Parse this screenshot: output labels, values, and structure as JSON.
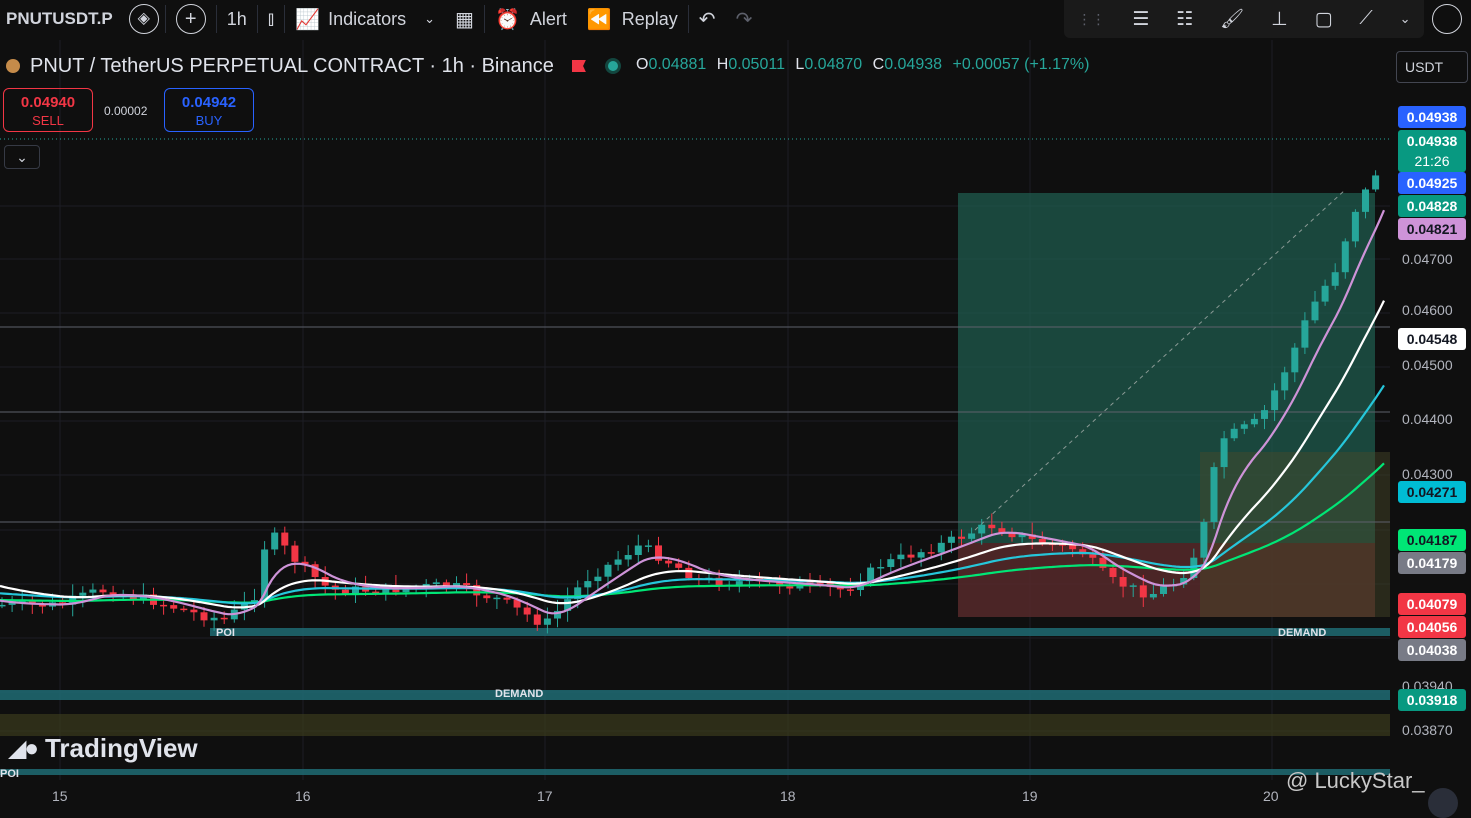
{
  "toolbar": {
    "symbol": "PNUTUSDT.P",
    "interval": "1h",
    "indicators_label": "Indicators",
    "alert_label": "Alert",
    "replay_label": "Replay"
  },
  "legend": {
    "title": "PNUT / TetherUS PERPETUAL CONTRACT · 1h · Binance",
    "o_key": "O",
    "o_val": "0.04881",
    "h_key": "H",
    "h_val": "0.05011",
    "l_key": "L",
    "l_val": "0.04870",
    "c_key": "C",
    "c_val": "0.04938",
    "change": "+0.00057 (+1.17%)"
  },
  "trade": {
    "sell_price": "0.04940",
    "sell_label": "SELL",
    "spread": "0.00002",
    "buy_price": "0.04942",
    "buy_label": "BUY"
  },
  "currency": "USDT",
  "price_axis": {
    "ticks": [
      "0.04700",
      "0.04600",
      "0.04500",
      "0.04400",
      "0.04300",
      "0.03940",
      "0.03870"
    ],
    "labels": [
      {
        "text": "0.04938",
        "bg": "#2962ff",
        "fg": "#ffffff"
      },
      {
        "text": "0.04938",
        "bg": "#089981",
        "fg": "#ffffff"
      },
      {
        "text": "21:26",
        "bg": "#089981",
        "fg": "#ffffff"
      },
      {
        "text": "0.04925",
        "bg": "#2962ff",
        "fg": "#ffffff"
      },
      {
        "text": "0.04828",
        "bg": "#089981",
        "fg": "#ffffff"
      },
      {
        "text": "0.04821",
        "bg": "#ce93d8",
        "fg": "#131722"
      },
      {
        "text": "0.04548",
        "bg": "#ffffff",
        "fg": "#131722"
      },
      {
        "text": "0.04271",
        "bg": "#00bcd4",
        "fg": "#131722"
      },
      {
        "text": "0.04187",
        "bg": "#00e676",
        "fg": "#131722"
      },
      {
        "text": "0.04179",
        "bg": "#787b86",
        "fg": "#ffffff"
      },
      {
        "text": "0.04079",
        "bg": "#f23645",
        "fg": "#ffffff"
      },
      {
        "text": "0.04056",
        "bg": "#f23645",
        "fg": "#ffffff"
      },
      {
        "text": "0.04038",
        "bg": "#787b86",
        "fg": "#ffffff"
      },
      {
        "text": "0.03918",
        "bg": "#089981",
        "fg": "#ffffff"
      }
    ]
  },
  "time_axis": [
    "15",
    "16",
    "17",
    "18",
    "19",
    "20"
  ],
  "zones": {
    "poi": "POI",
    "demand": "DEMAND",
    "demand2": "DEMAND",
    "poi2": "POI"
  },
  "branding": {
    "logo": "TradingView",
    "watermark": "@ LuckyStar_"
  },
  "colors": {
    "up": "#26a69a",
    "down": "#f23645",
    "ema_fast": "#ce93d8",
    "ema_mid": "#ffffff",
    "ema_slow": "#26c6da",
    "ema_long": "#00e676"
  }
}
